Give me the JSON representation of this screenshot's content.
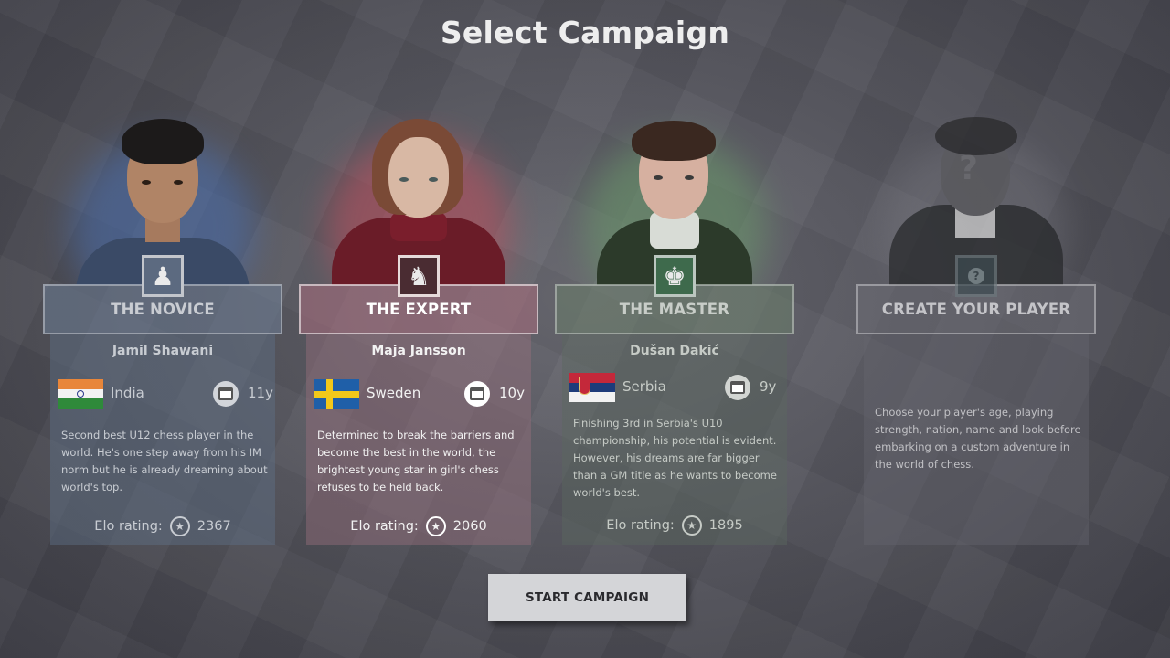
{
  "screen_title": "Select Campaign",
  "campaigns": [
    {
      "title": "THE NOVICE",
      "player_name": "Jamil Shawani",
      "country": "India",
      "age": "11y",
      "description": "Second best U12 chess player in the world. He's one step away from his IM norm but he is already dreaming about world's top.",
      "elo_label": "Elo rating:",
      "elo_value": "2367",
      "badge_icon": "pawn-icon",
      "accent": "#5c6a80"
    },
    {
      "title": "THE EXPERT",
      "player_name": "Maja Jansson",
      "country": "Sweden",
      "age": "10y",
      "description": "Determined to break the barriers and become the best in the world, the brightest young star in girl's chess refuses to be held back.",
      "elo_label": "Elo rating:",
      "elo_value": "2060",
      "badge_icon": "knight-icon",
      "accent": "#4a2c32",
      "selected": true
    },
    {
      "title": "THE MASTER",
      "player_name": "Dušan Dakić",
      "country": "Serbia",
      "age": "9y",
      "description": "Finishing  3rd in Serbia's U10 championship, his potential is evident. However, his dreams are far bigger than a GM title as he wants to become world's best.",
      "elo_label": "Elo rating:",
      "elo_value": "1895",
      "badge_icon": "king-icon",
      "accent": "#3e6a4c"
    },
    {
      "title": "CREATE YOUR PLAYER",
      "description": "Choose your player's age, playing strength, nation, name and look before embarking on a custom adventure in the world of chess.",
      "badge_icon": "question-icon"
    }
  ],
  "start_button": "START CAMPAIGN"
}
